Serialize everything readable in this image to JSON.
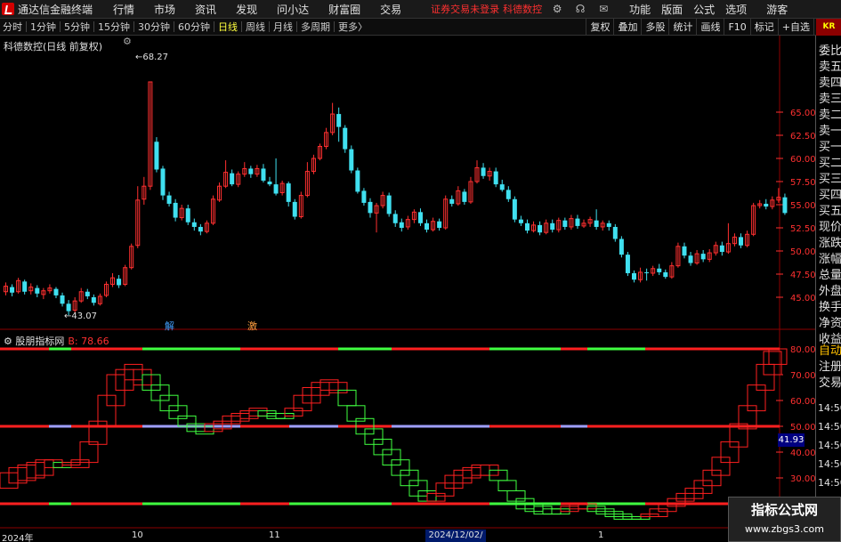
{
  "app": {
    "title": "通达信金融终端",
    "menu": [
      "行情",
      "市场",
      "资讯",
      "发现",
      "问小达",
      "财富圈",
      "交易"
    ],
    "status": "证券交易未登录",
    "stock_name_top": "科德数控",
    "right_menu": [
      "功能",
      "版面",
      "公式",
      "选项"
    ],
    "guest": "游客"
  },
  "toolbar": {
    "periods": [
      "分时",
      "1分钟",
      "5分钟",
      "15分钟",
      "30分钟",
      "60分钟",
      "日线",
      "周线",
      "月线",
      "多周期",
      "更多"
    ],
    "active_period": "日线",
    "more_suffix": "〉",
    "buttons": [
      "复权",
      "叠加",
      "多股",
      "统计",
      "画线",
      "F10",
      "标记",
      "+自选",
      "返回"
    ]
  },
  "chart": {
    "stock_title": "科德数控(日线 前复权)",
    "indicator_title": "股朋指标网",
    "indicator_value": "B: 78.66",
    "max_label": "68.27",
    "min_label": "43.07",
    "tag_jie": "解",
    "tag_ji": "激",
    "value_box": "41.93",
    "x_labels": [
      "2024年",
      "10",
      "11",
      "1"
    ],
    "x_date_box": "2024/12/02/一",
    "right_kr": "KR"
  },
  "right_panel": {
    "items": [
      "委比",
      "卖五",
      "卖四",
      "卖三",
      "卖二",
      "卖一",
      "买一",
      "买二",
      "买三",
      "买四",
      "买五",
      "现价",
      "涨跌",
      "涨幅",
      "总量",
      "外盘",
      "换手",
      "净资",
      "收益"
    ],
    "lower_items": [
      "自动",
      "注册",
      "交易"
    ],
    "times": [
      "14:50",
      "14:50",
      "14:50",
      "14:50",
      "14:50",
      "14:50",
      "14:50"
    ]
  },
  "watermark": {
    "line1": "指标公式网",
    "line2": "www.zbgs3.com"
  },
  "colors": {
    "up": "#ff3030",
    "down": "#40e0f0",
    "ind_red": "#ff2020",
    "ind_green": "#40ff40",
    "ind_purple": "#a0a0ff"
  },
  "chart_data": {
    "type": "candlestick",
    "price_axis": [
      65.0,
      62.5,
      60.0,
      57.5,
      55.0,
      52.5,
      50.0,
      47.5,
      45.0
    ],
    "price_range": [
      43.07,
      68.27
    ],
    "indicator_axis": [
      80.0,
      70.0,
      60.0,
      50.0,
      40.0,
      30.0
    ],
    "indicator_range": [
      15,
      85
    ],
    "reference_levels": [
      80,
      50,
      20
    ]
  }
}
